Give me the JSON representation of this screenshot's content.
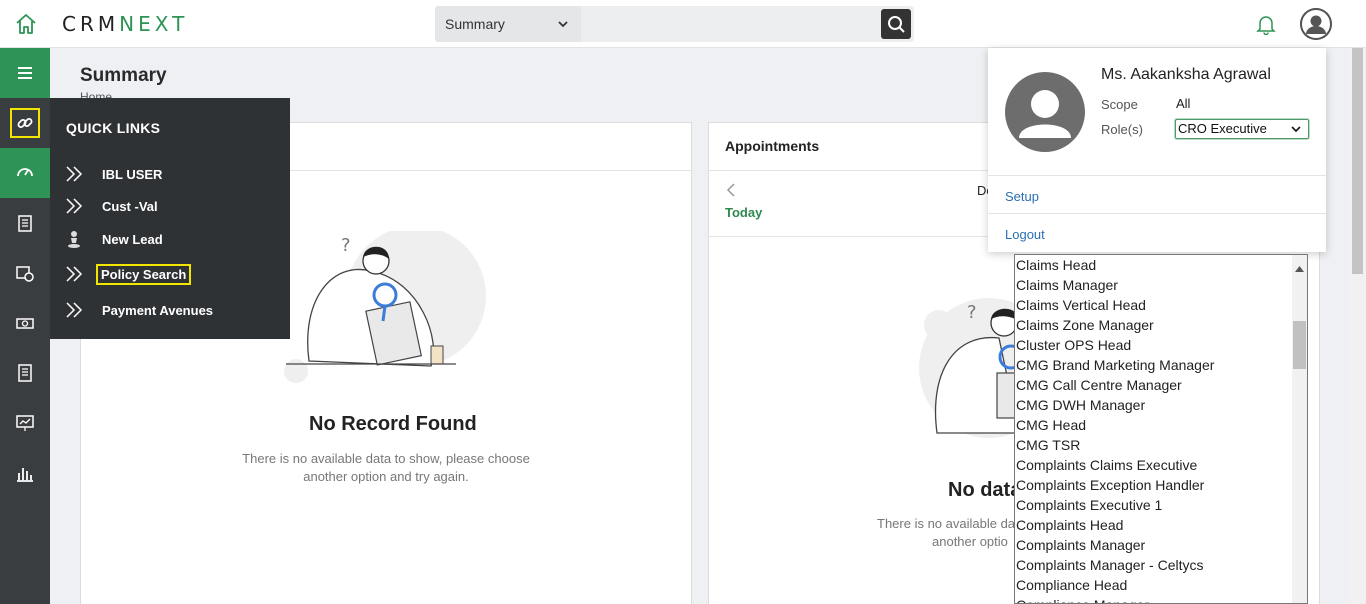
{
  "app": {
    "logo_main": "CRMNEXT",
    "accent_color": "#2e9456"
  },
  "search": {
    "scope_value": "Summary",
    "placeholder": ""
  },
  "page": {
    "title": "Summary",
    "breadcrumb": "Home"
  },
  "quick_links": {
    "title": "QUICK LINKS",
    "items": [
      {
        "label": "IBL USER",
        "icon": "double-chevron-icon"
      },
      {
        "label": "Cust -Val",
        "icon": "double-chevron-icon"
      },
      {
        "label": "New Lead",
        "icon": "person-icon"
      },
      {
        "label": "Policy Search",
        "icon": "double-chevron-icon"
      },
      {
        "label": "Payment Avenues",
        "icon": "double-chevron-icon"
      }
    ]
  },
  "card_left": {
    "empty_title": "No Record Found",
    "empty_desc_line1": "There is no available data to show, please choose",
    "empty_desc_line2": "another option and try again."
  },
  "card_appointments": {
    "title": "Appointments",
    "today": "Today",
    "date_partial": "De",
    "empty_title_partial": "No data",
    "empty_desc_line1_partial": "There is no available dat",
    "empty_desc_line2_partial": "another optio"
  },
  "profile": {
    "name": "Ms. Aakanksha Agrawal",
    "scope_label": "Scope",
    "scope_value": "All",
    "roles_label": "Role(s)",
    "role_selected": "CRO Executive",
    "setup": "Setup",
    "logout": "Logout"
  },
  "role_options": [
    "Claims Head",
    "Claims Manager",
    "Claims Vertical Head",
    "Claims Zone Manager",
    "Cluster OPS Head",
    "CMG Brand Marketing Manager",
    "CMG Call Centre Manager",
    "CMG DWH Manager",
    "CMG Head",
    "CMG TSR",
    "Complaints Claims Executive",
    "Complaints Exception Handler",
    "Complaints Executive 1",
    "Complaints Head",
    "Complaints Manager",
    "Complaints Manager - Celtycs",
    "Compliance Head",
    "Compliance Manager"
  ]
}
